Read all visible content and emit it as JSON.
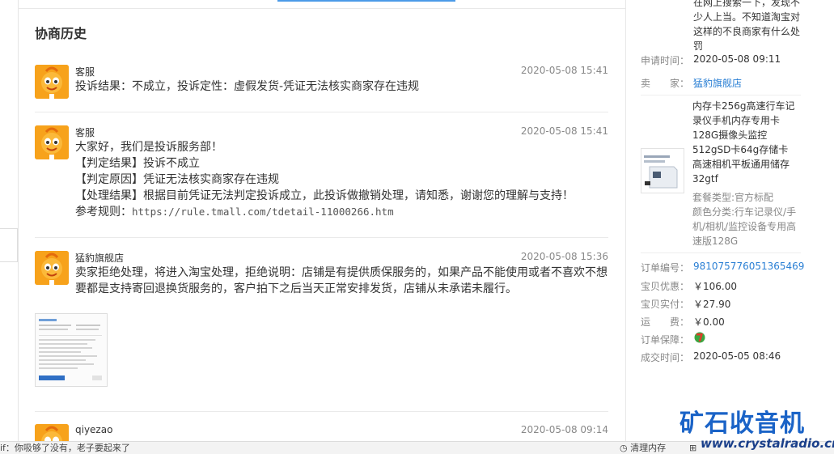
{
  "title": "协商历史",
  "messages": [
    {
      "author": "客服",
      "time": "2020-05-08 15:41",
      "lines": [
        "投诉结果：不成立，投诉定性：虚假发货-凭证无法核实商家存在违规"
      ]
    },
    {
      "author": "客服",
      "time": "2020-05-08 15:41",
      "lines": [
        "大家好，我们是投诉服务部！",
        "【判定结果】投诉不成立",
        "【判定原因】凭证无法核实商家存在违规",
        "【处理结果】根据目前凭证无法判定投诉成立，此投诉做撤销处理，请知悉，谢谢您的理解与支持！"
      ],
      "ref_label": "参考规则：",
      "ref_url": "https://rule.tmall.com/tdetail-11000266.htm"
    },
    {
      "author": "猛豹旗舰店",
      "time": "2020-05-08 15:36",
      "lines": [
        "卖家拒绝处理，将进入淘宝处理，拒绝说明：店铺是有提供质保服务的，如果产品不能使用或者不喜欢不想要都是支持寄回退换货服务的，客户拍下之后当天正常安排发货，店铺从未承诺未履行。"
      ]
    },
    {
      "author": "qiyezao",
      "time": "2020-05-08 09:14",
      "lines": []
    }
  ],
  "right": {
    "top_text": "在网上搜索一下，发现不少人上当。不知道淘宝对这样的不良商家有什么处罚",
    "apply_time_label": "申请时间：",
    "apply_time": "2020-05-08 09:11",
    "seller_label": "卖　　家：",
    "seller": "猛豹旗舰店",
    "product_title": "内存卡256g高速行车记录仪手机内存专用卡128G摄像头监控512gSD卡64g存储卡高速相机平板通用储存32gtf",
    "sku_lines": [
      "套餐类型:官方标配",
      "颜色分类:行车记录仪/手机/相机/监控设备专用高速版128G"
    ],
    "order_no_label": "订单编号：",
    "order_no": "981075776051365469",
    "discount_label": "宝贝优惠：",
    "discount": "￥106.00",
    "paid_label": "宝贝实付：",
    "paid": "￥27.90",
    "shipping_label": "运　　费：",
    "shipping": "￥0.00",
    "guarantee_label": "订单保障：",
    "deal_time_label": "成交时间：",
    "deal_time": "2020-05-05 08:46"
  },
  "statusbar": {
    "tip": "if：你吸够了没有，老子要起来了",
    "clear_memory": "清理内存"
  },
  "watermark": {
    "text": "矿石收音机",
    "url": "www.crystalradio.cn"
  },
  "colors": {
    "link": "#2a7fd4",
    "avatar": "#f7a21b",
    "accent": "#4b9be8"
  }
}
